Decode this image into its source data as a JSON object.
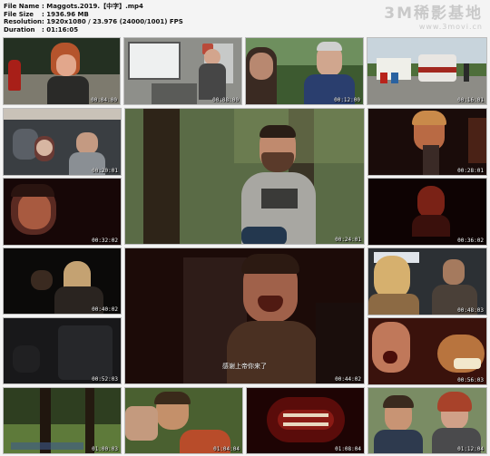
{
  "file_info": {
    "rows": [
      {
        "key": "File Name",
        "value": ": Maggots.2019.【中字】.mp4"
      },
      {
        "key": "File Size",
        "value": ": 1936.96 MB"
      },
      {
        "key": "Resolution",
        "value": ": 1920x1080 / 23.976 (24000/1001) FPS"
      },
      {
        "key": "Duration",
        "value": ": 01:16:05"
      }
    ]
  },
  "watermark": {
    "title": "3M稀影基地",
    "url": "www.3movi.cn"
  },
  "thumbnails": [
    {
      "time": "00:04:00",
      "subtitle": "",
      "bg": "#3e4a3c"
    },
    {
      "time": "00:08:00",
      "subtitle": "",
      "bg": "#6e6f6c"
    },
    {
      "time": "00:12:00",
      "subtitle": "",
      "bg": "#4a6a3e"
    },
    {
      "time": "00:16:01",
      "subtitle": "",
      "bg": "#8a9280"
    },
    {
      "time": "00:20:01",
      "subtitle": "",
      "bg": "#2a2d30"
    },
    {
      "time": "00:24:01",
      "subtitle": "",
      "bg": "#41513a"
    },
    {
      "time": "00:28:01",
      "subtitle": "",
      "bg": "#3a1a14"
    },
    {
      "time": "00:32:02",
      "subtitle": "",
      "bg": "#1e0a0a"
    },
    {
      "time": "00:36:02",
      "subtitle": "",
      "bg": "#1a0606"
    },
    {
      "time": "00:40:02",
      "subtitle": "",
      "bg": "#0e0d0c"
    },
    {
      "time": "00:44:02",
      "subtitle": "感谢上帝你来了",
      "bg": "#2a1410"
    },
    {
      "time": "00:48:03",
      "subtitle": "",
      "bg": "#3a3f44"
    },
    {
      "time": "00:52:03",
      "subtitle": "",
      "bg": "#1e1e20"
    },
    {
      "time": "00:56:03",
      "subtitle": "",
      "bg": "#4a1a12"
    },
    {
      "time": "01:00:03",
      "subtitle": "",
      "bg": "#3b4d2a"
    },
    {
      "time": "01:04:04",
      "subtitle": "",
      "bg": "#5a6a3a"
    },
    {
      "time": "01:08:04",
      "subtitle": "",
      "bg": "#2a0606"
    },
    {
      "time": "01:12:04",
      "subtitle": "",
      "bg": "#5d6a55"
    }
  ]
}
